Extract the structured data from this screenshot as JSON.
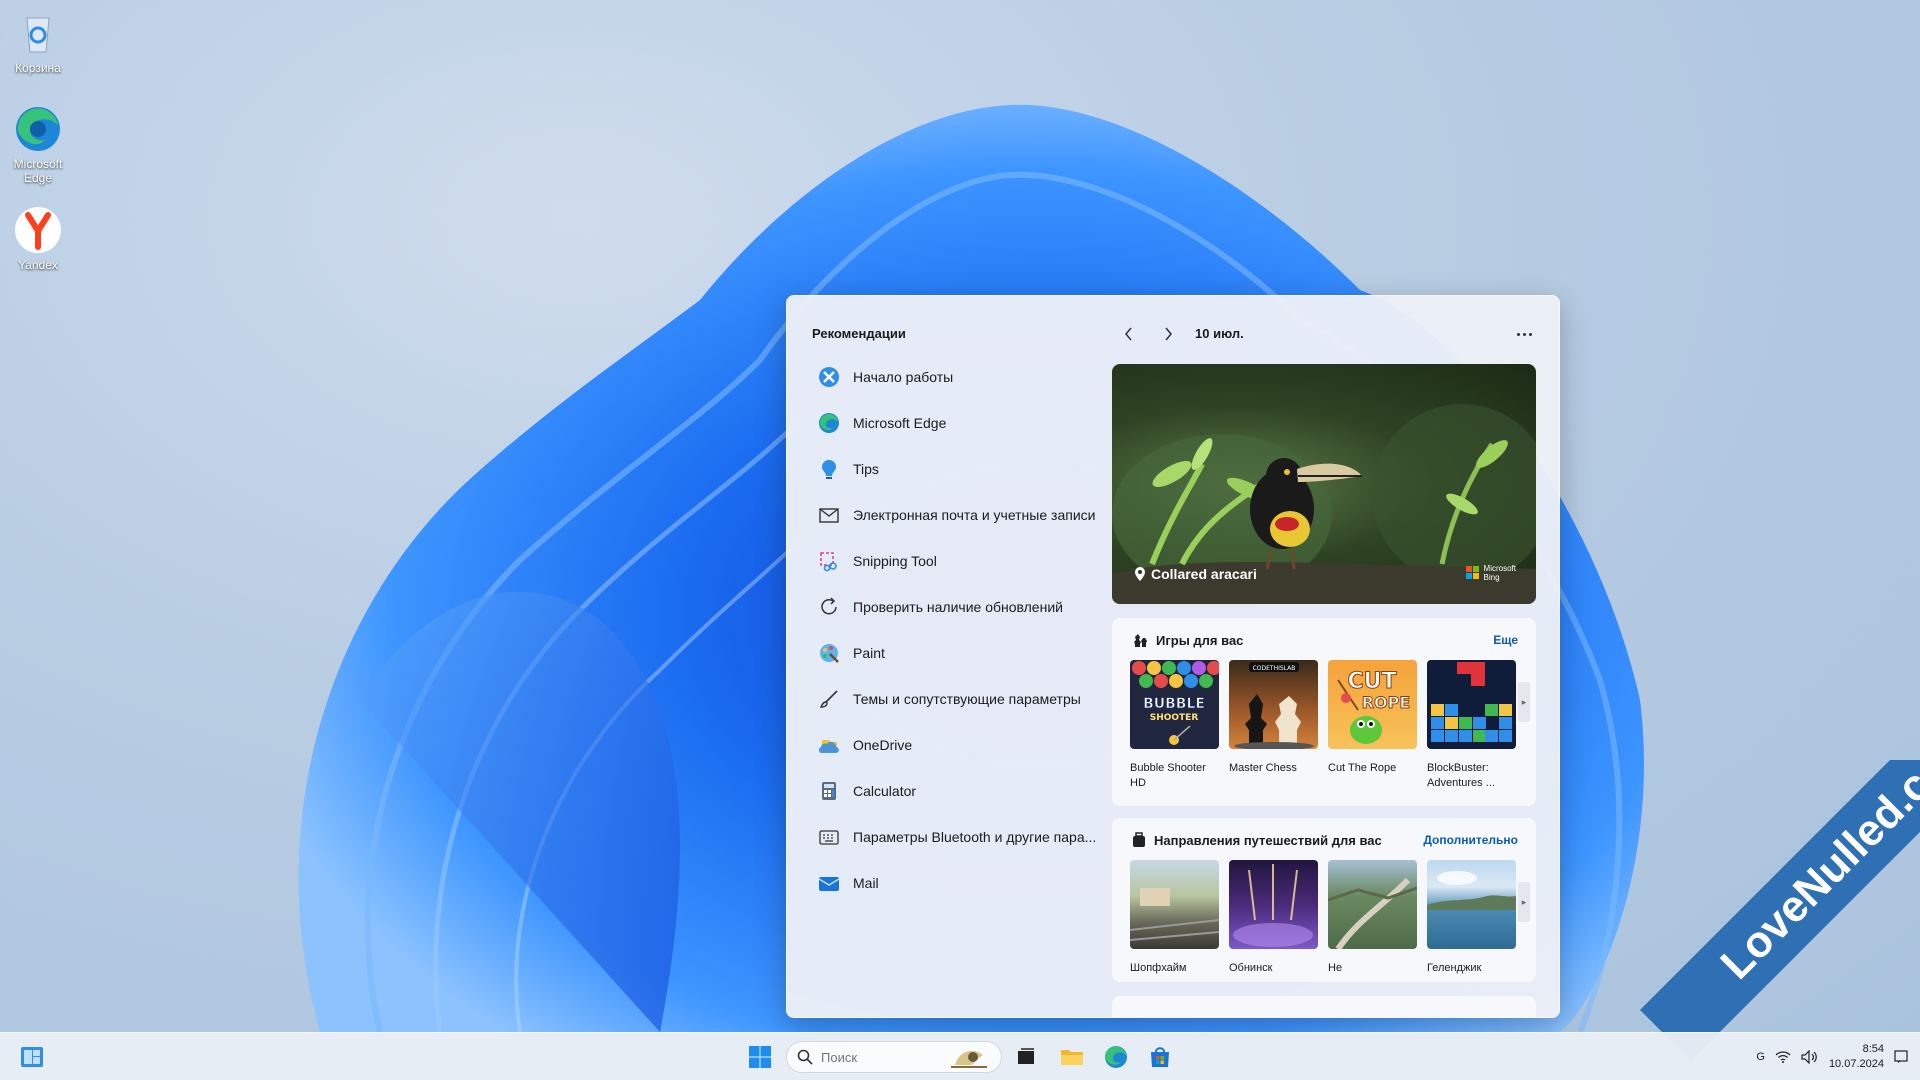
{
  "desktop": {
    "icons": [
      {
        "label": "Корзина",
        "icon": "recycle-bin-icon"
      },
      {
        "label": "Microsoft Edge",
        "icon": "edge-icon"
      },
      {
        "label": "Yandex",
        "icon": "yandex-icon"
      }
    ]
  },
  "panel": {
    "title": "Рекомендации",
    "date": "10 июл.",
    "recommendations": [
      {
        "label": "Начало работы",
        "icon": "get-started-icon"
      },
      {
        "label": "Microsoft Edge",
        "icon": "edge-icon"
      },
      {
        "label": "Tips",
        "icon": "tips-icon"
      },
      {
        "label": "Электронная почта и учетные записи",
        "icon": "mail-outline-icon"
      },
      {
        "label": "Snipping Tool",
        "icon": "snipping-tool-icon"
      },
      {
        "label": "Проверить наличие обновлений",
        "icon": "refresh-icon"
      },
      {
        "label": "Paint",
        "icon": "paint-icon"
      },
      {
        "label": "Темы и сопутствующие параметры",
        "icon": "brush-icon"
      },
      {
        "label": "OneDrive",
        "icon": "onedrive-icon"
      },
      {
        "label": "Calculator",
        "icon": "calculator-icon"
      },
      {
        "label": "Параметры Bluetooth и другие пара...",
        "icon": "keyboard-icon"
      },
      {
        "label": "Mail",
        "icon": "mail-app-icon"
      }
    ],
    "hero": {
      "caption": "Collared aracari",
      "brand_line1": "Microsoft",
      "brand_line2": "Bing"
    },
    "games": {
      "title": "Игры для вас",
      "link": "Еще",
      "items": [
        {
          "line1": "Bubble Shooter",
          "line2": "HD",
          "thumb_text": "BUBBLE SHOOTER"
        },
        {
          "line1": "Master Chess",
          "line2": "",
          "thumb_text": "CODETHISLAB"
        },
        {
          "line1": "Cut The Rope",
          "line2": "",
          "thumb_text": "CUT THE ROPE"
        },
        {
          "line1": "BlockBuster:",
          "line2": "Adventures ...",
          "thumb_text": ""
        }
      ]
    },
    "travel": {
      "title": "Направления путешествий для вас",
      "link": "Дополнительно",
      "items": [
        {
          "label": "Шопфхайм"
        },
        {
          "label": "Обнинск"
        },
        {
          "label": "Не"
        },
        {
          "label": "Геленджик"
        }
      ]
    }
  },
  "taskbar": {
    "search_placeholder": "Поиск",
    "clock_time": "8:54",
    "clock_date": "10.07.2024",
    "lang": "G"
  },
  "watermark": "LoveNulled.com",
  "colors": {
    "accent": "#0b5cad",
    "bloom": "#1f6fe8",
    "watermark_band": "#2f6fb4"
  }
}
